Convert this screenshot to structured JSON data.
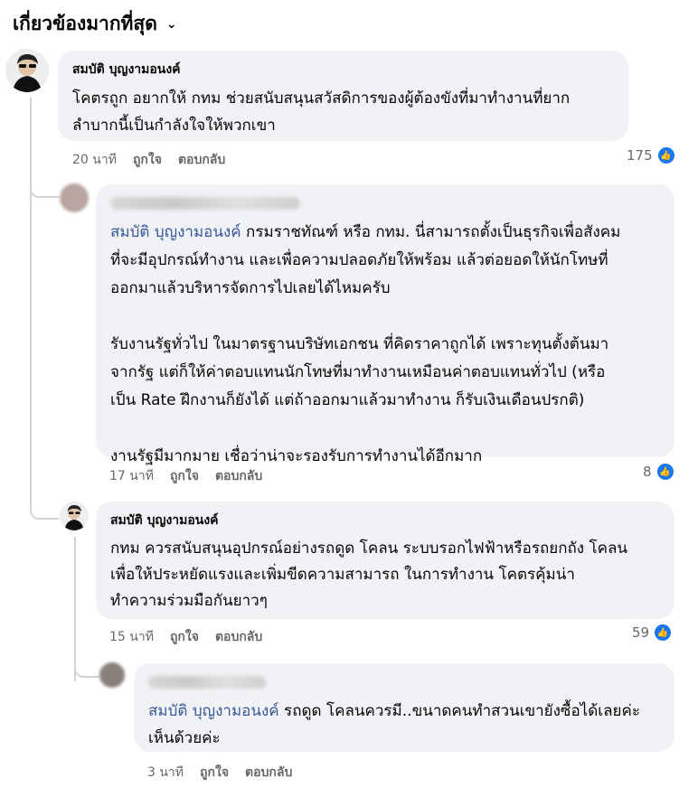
{
  "header": {
    "title": "เกี่ยวข้องมากที่สุด",
    "chevron": "⌄"
  },
  "comments": [
    {
      "author": "สมบัติ บุญงามอนงค์",
      "text": "โคตรถูก อยากให้ กทม ช่วยสนับสนุนสวัสดิการของผู้ต้องขังที่มาทำงานที่ยาก\nลำบากนี้เป็นกำลังใจให้พวกเขา",
      "time": "20 นาที",
      "like_label": "ถูกใจ",
      "reply_label": "ตอบกลับ",
      "likes": "175"
    },
    {
      "mention": "สมบัติ บุญงามอนงค์",
      "text": " กรมราชทัณฑ์ หรือ กทม. นี่สามารถตั้งเป็นธุรกิจเพื่อสังคม\nที่จะมีอุปกรณ์ทำงาน และเพื่อความปลอดภัยให้พร้อม แล้วต่อยอดให้นักโทษที่\nออกมาแล้วบริหารจัดการไปเลยได้ไหมครับ\n\nรับงานรัฐทั่วไป ในมาตรฐานบริษัทเอกชน ที่คิดราคาถูกได้ เพราะทุนตั้งต้นมา\nจากรัฐ แต่ก็ให้ค่าตอบแทนนักโทษที่มาทำงานเหมือนค่าตอบแทนทั่วไป (หรือ\nเป็น Rate ฝึกงานก็ยังได้ แต่ถ้าออกมาแล้วมาทำงาน ก็รับเงินเดือนปรกติ)\n\nงานรัฐมีมากมาย เชื่อว่าน่าจะรองรับการทำงานได้อีกมาก",
      "time": "17 นาที",
      "like_label": "ถูกใจ",
      "reply_label": "ตอบกลับ",
      "likes": "8"
    },
    {
      "author": "สมบัติ บุญงามอนงค์",
      "text": "กทม ควรสนับสนุนอุปกรณ์อย่างรถดูด โคลน ระบบรอกไฟฟ้าหรือรถยกถัง โคลน\nเพื่อให้ประหยัดแรงและเพิ่มขีดความสามารถ ในการทำงาน โคตรคุ้มน่า\nทำความร่วมมือกันยาวๆ",
      "time": "15 นาที",
      "like_label": "ถูกใจ",
      "reply_label": "ตอบกลับ",
      "likes": "59"
    },
    {
      "mention": "สมบัติ บุญงามอนงค์",
      "text": " รถดูด โคลนควรมี..ขนาดคนทำสวนเขายังซื้อได้เลยค่ะ\nเห็นด้วยค่ะ",
      "time": "3 นาที",
      "like_label": "ถูกใจ",
      "reply_label": "ตอบกลับ"
    }
  ],
  "colors": {
    "bubble": "#f0f2f5",
    "like_blue": "#1877f2",
    "mention": "#385898",
    "meta": "#65676b"
  },
  "icons": {
    "like": "thumbs-up-icon",
    "chevron": "chevron-down-icon"
  }
}
